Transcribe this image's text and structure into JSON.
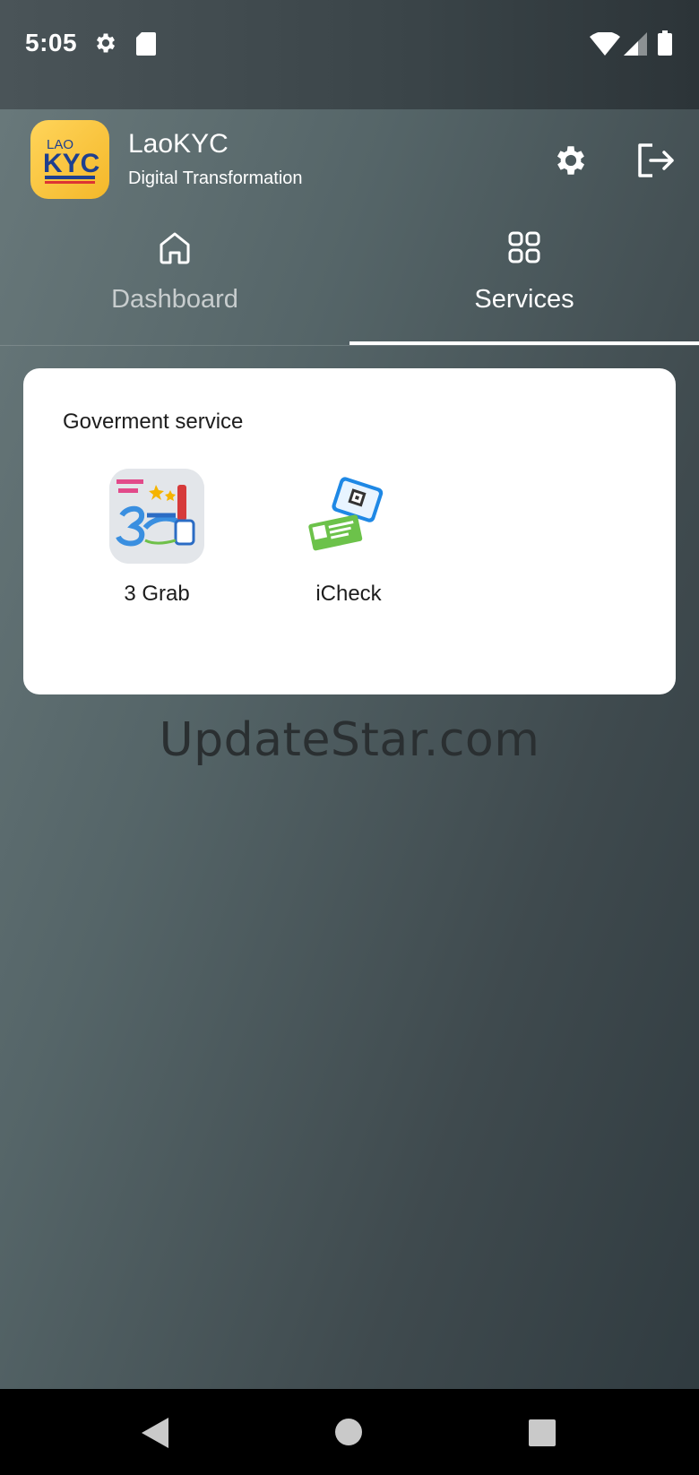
{
  "status_bar": {
    "time": "5:05",
    "icons": [
      "gear-icon",
      "sd-card-icon",
      "wifi-icon",
      "signal-icon",
      "battery-icon"
    ]
  },
  "header": {
    "app_name": "LaoKYC",
    "tagline": "Digital Transformation",
    "logo_text_top": "LAO",
    "logo_text_main": "KYC",
    "settings_icon": "gear-icon",
    "logout_icon": "logout-icon"
  },
  "tabs": [
    {
      "label": "Dashboard",
      "icon": "home-icon",
      "selected": false
    },
    {
      "label": "Services",
      "icon": "grid-icon",
      "selected": true
    }
  ],
  "services_card": {
    "section_title": "Goverment service",
    "items": [
      {
        "label": "3 Grab",
        "icon": "three-grab-app-icon"
      },
      {
        "label": "iCheck",
        "icon": "icheck-app-icon"
      }
    ]
  },
  "watermark": "UpdateStar.com",
  "nav_bar": {
    "icons": [
      "back-icon",
      "home-circle-icon",
      "recents-icon"
    ]
  },
  "colors": {
    "logo_yellow": "#f4b82a",
    "logo_blue": "#1e3f8f",
    "card_bg": "#ffffff",
    "tab_indicator": "#ffffff",
    "nav_bg": "#000000"
  }
}
